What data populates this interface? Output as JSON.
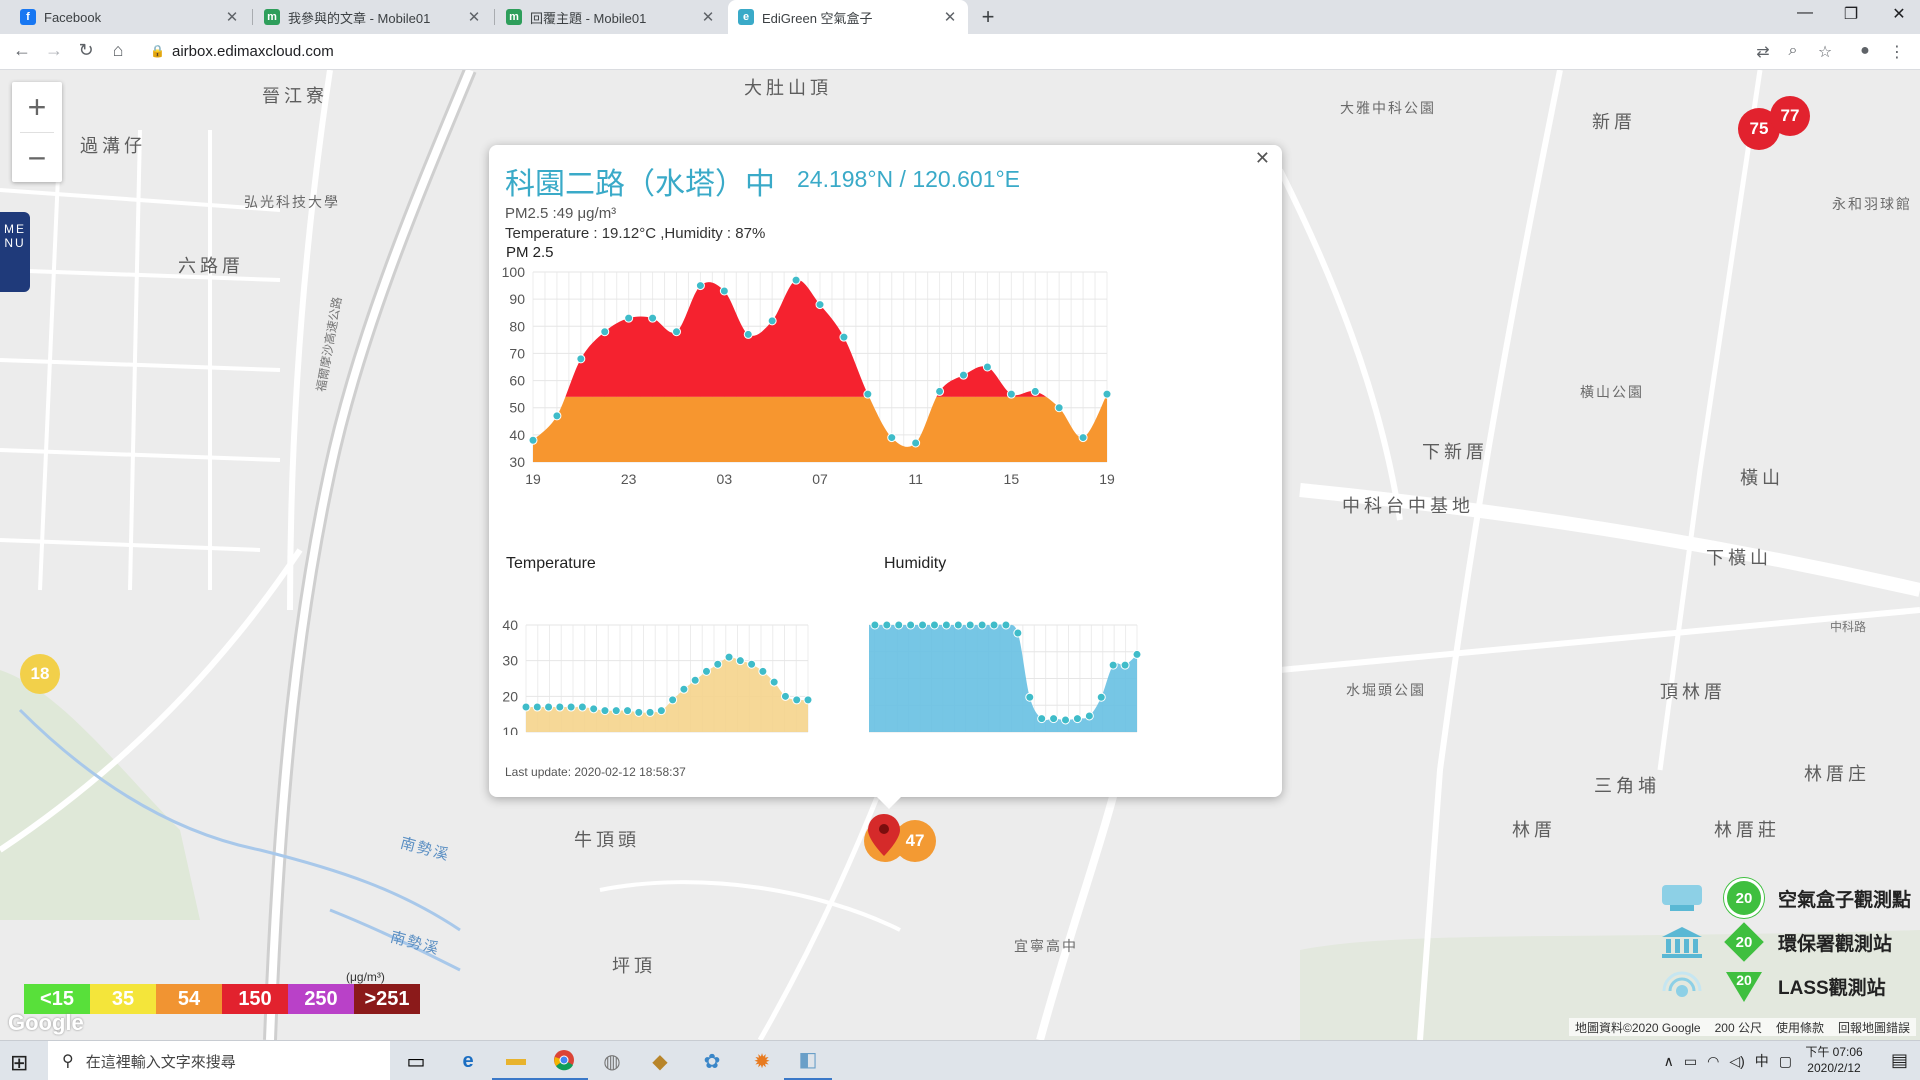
{
  "browser": {
    "tabs": [
      {
        "title": "Facebook",
        "icon": "facebook-icon",
        "color": "#1877f2",
        "glyph": "f"
      },
      {
        "title": "我參與的文章 - Mobile01",
        "icon": "mobile01-icon",
        "color": "#2e9e5b",
        "glyph": "m"
      },
      {
        "title": "回覆主題 - Mobile01",
        "icon": "mobile01-icon",
        "color": "#2e9e5b",
        "glyph": "m"
      },
      {
        "title": "EdiGreen 空氣盒子",
        "icon": "edigreen-icon",
        "color": "#3aaac8",
        "glyph": "e"
      }
    ],
    "url": "airbox.edimaxcloud.com"
  },
  "map": {
    "labels": [
      {
        "text": "晉江寮",
        "cls": "big"
      },
      {
        "text": "大肚山頂",
        "cls": "big"
      },
      {
        "text": "大雅中科公園",
        "cls": ""
      },
      {
        "text": "新厝",
        "cls": "big"
      },
      {
        "text": "過溝仔",
        "cls": "big"
      },
      {
        "text": "弘光科技大學",
        "cls": ""
      },
      {
        "text": "六路厝",
        "cls": "big"
      },
      {
        "text": "永和羽球館",
        "cls": ""
      },
      {
        "text": "中科台中基地",
        "cls": "big"
      },
      {
        "text": "下新厝",
        "cls": "big"
      },
      {
        "text": "橫山公園",
        "cls": ""
      },
      {
        "text": "橫山",
        "cls": "big"
      },
      {
        "text": "下橫山",
        "cls": "big"
      },
      {
        "text": "水堀頭公園",
        "cls": ""
      },
      {
        "text": "頂林厝",
        "cls": "big"
      },
      {
        "text": "三角埔",
        "cls": "big"
      },
      {
        "text": "林厝庄",
        "cls": "big"
      },
      {
        "text": "林厝",
        "cls": "big"
      },
      {
        "text": "林厝莊",
        "cls": "big"
      },
      {
        "text": "牛頂頭",
        "cls": "big"
      },
      {
        "text": "坪頂",
        "cls": "big"
      },
      {
        "text": "宜寧高中",
        "cls": ""
      },
      {
        "text": "南勢溪",
        "cls": "water"
      },
      {
        "text": "南勢溪",
        "cls": "water"
      },
      {
        "text": "福爾摩沙高速公路",
        "cls": "road"
      },
      {
        "text": "中科路",
        "cls": "road"
      }
    ],
    "markers": [
      {
        "value": "75",
        "color": "#e2222e"
      },
      {
        "value": "77",
        "color": "#e2222e"
      },
      {
        "value": "18",
        "color": "#f2d04a"
      },
      {
        "value": "47",
        "color": "#f39a33"
      },
      {
        "value": "49",
        "color": "#f39a33"
      }
    ],
    "menu_label": "MENU",
    "aqi_unit": "(μg/m³)",
    "aqi_scale": [
      {
        "label": "<15",
        "color": "#58e03a"
      },
      {
        "label": "35",
        "color": "#f4e53a"
      },
      {
        "label": "54",
        "color": "#f19432"
      },
      {
        "label": "150",
        "color": "#e2222e"
      },
      {
        "label": "250",
        "color": "#b941c8"
      },
      {
        "label": ">251",
        "color": "#8b1a1a"
      }
    ],
    "legend": [
      {
        "icon": "airbox-icon",
        "value": "20",
        "label": "空氣盒子觀測點",
        "shape": "circle"
      },
      {
        "icon": "government-building-icon",
        "value": "20",
        "label": "環保署觀測站",
        "shape": "diamond"
      },
      {
        "icon": "lass-sensor-icon",
        "value": "20",
        "label": "LASS觀測站",
        "shape": "triangle"
      }
    ],
    "legend_color": "#3fbf3f",
    "attribution": [
      "地圖資料©2020 Google",
      "200 公尺",
      "使用條款",
      "回報地圖錯誤"
    ],
    "google_logo": "Google"
  },
  "popup": {
    "title": "科園二路（水塔）中",
    "coords": "24.198°N / 120.601°E",
    "pm25_line": "PM2.5 :49 μg/m³",
    "temp_line": "Temperature : 19.12°C ,Humidity : 87%",
    "pm_chart_title": "PM 2.5",
    "temp_chart_title": "Temperature",
    "humidity_chart_title": "Humidity",
    "last_update": "Last update: 2020-02-12 18:58:37"
  },
  "chart_data": [
    {
      "type": "area",
      "title": "PM 2.5",
      "ylim": [
        30,
        100
      ],
      "yticks": [
        30,
        40,
        50,
        60,
        70,
        80,
        90,
        100
      ],
      "xtick_labels": [
        "19",
        "23",
        "03",
        "07",
        "11",
        "15",
        "19"
      ],
      "threshold": 54,
      "colors": {
        "above": "#f5222f",
        "below": "#f7962f",
        "point": "#3fbcc9"
      },
      "values": [
        38,
        47,
        68,
        78,
        83,
        83,
        78,
        95,
        93,
        77,
        82,
        97,
        88,
        76,
        55,
        39,
        37,
        56,
        62,
        65,
        55,
        56,
        50,
        39,
        55
      ]
    },
    {
      "type": "area",
      "title": "Temperature",
      "ylim": [
        10,
        40
      ],
      "yticks": [
        10,
        20,
        30,
        40
      ],
      "colors": {
        "fill": "#f5d48c",
        "point": "#3fbcc9"
      },
      "values": [
        17,
        17,
        17,
        17,
        17,
        17,
        16.5,
        16,
        16,
        16,
        15.5,
        15.5,
        16,
        19,
        22,
        24.5,
        27,
        29,
        31,
        30,
        29,
        27,
        24,
        20,
        19,
        19
      ]
    },
    {
      "type": "area",
      "title": "Humidity",
      "ylim": [
        60,
        100
      ],
      "yticks": [
        60,
        70,
        80,
        90,
        100
      ],
      "colors": {
        "fill": "#67c0e2",
        "point": "#3fbcc9"
      },
      "values": [
        100,
        100,
        100,
        100,
        100,
        100,
        100,
        100,
        100,
        100,
        100,
        100,
        100,
        97,
        73,
        65,
        65,
        64.5,
        65,
        66,
        73,
        85,
        85,
        89
      ]
    }
  ],
  "taskbar": {
    "search_placeholder": "在這裡輸入文字來搜尋",
    "time": "下午 07:06",
    "date": "2020/2/12",
    "tray_lang": "中"
  }
}
